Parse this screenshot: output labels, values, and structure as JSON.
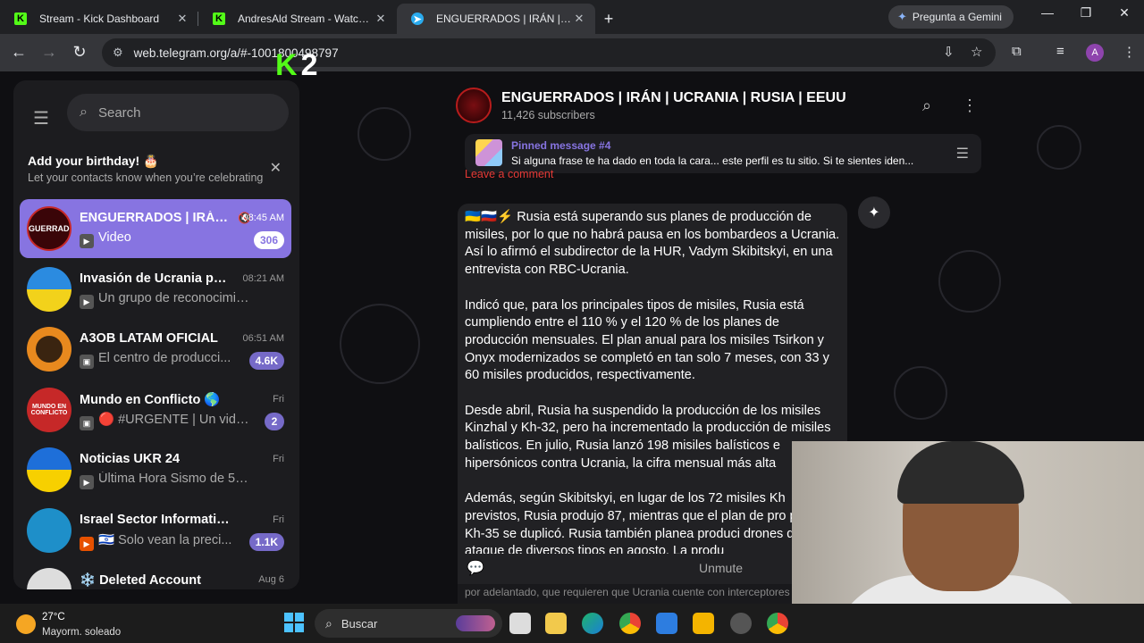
{
  "browser": {
    "tabs": [
      {
        "title": "Stream - Kick Dashboard",
        "icon": "kick-icon"
      },
      {
        "title": "AndresAld Stream - Watch Live",
        "icon": "kick-icon"
      },
      {
        "title": "ENGUERRADOS | IRÁN | UCRAN",
        "icon": "telegram-icon"
      }
    ],
    "gemini_label": "Pregunta a Gemini",
    "url": "web.telegram.org/a/#-1001800498797",
    "profile_initial": "A"
  },
  "overlay": {
    "kick_number": "2"
  },
  "sidebar": {
    "search_placeholder": "Search",
    "birthday": {
      "title": "Add your birthday! 🎂",
      "subtitle": "Let your contacts know when you’re celebrating"
    },
    "chats": [
      {
        "name": "ENGUERRADOS | IRÁN...",
        "time": "08:45 AM",
        "preview": "Video",
        "badge": "306",
        "avatar_text": "ENGUERRADOS"
      },
      {
        "name": "Invasión de Ucrania por ...",
        "time": "08:21 AM",
        "preview": "Un grupo de reconocimiento ...",
        "badge": "",
        "avatar_text": ""
      },
      {
        "name": "A3OB LATAM OFICIAL",
        "time": "06:51 AM",
        "preview": "El centro de producci...",
        "badge": "4.6K",
        "avatar_text": ""
      },
      {
        "name": "Mundo en Conflicto 🌎",
        "time": "Fri",
        "preview": "🔴 #URGENTE | Un video...",
        "badge": "2",
        "avatar_text": "MUNDO EN CONFLICTO"
      },
      {
        "name": "Noticias UKR 24",
        "time": "Fri",
        "preview": "Última Hora Sismo de 5.0 en...",
        "badge": "",
        "avatar_text": ""
      },
      {
        "name": "Israel Sector Informativo - Ca...",
        "time": "Fri",
        "preview": "🇮🇱 Solo vean la preci...",
        "badge": "1.1K",
        "avatar_text": ""
      },
      {
        "name": "❄️ Deleted Account",
        "time": "Aug 6",
        "preview": "",
        "badge": "",
        "avatar_text": ""
      }
    ]
  },
  "channel": {
    "title": "ENGUERRADOS | IRÁN | UCRANIA | RUSIA | EEUU",
    "subscribers": "11,426 subscribers",
    "pinned_label": "Pinned message #4",
    "pinned_text": "Si alguna frase te ha dado en toda la cara... este perfil es tu sitio. Si te sientes iden...",
    "comment_peek": "Leave a comment",
    "unmute_label": "Unmute"
  },
  "message": {
    "paragraphs": [
      "🇺🇦🇷🇺⚡ Rusia está superando sus planes de producción de misiles, por lo que no habrá pausa en los bombardeos a Ucrania. Así lo afirmó el subdirector de la HUR, Vadym Skibitskyi, en una entrevista con RBC-Ucrania.",
      "Indicó que, para los principales tipos de misiles, Rusia está cumpliendo entre el 110 % y el 120 % de los planes de producción mensuales. El plan anual para los misiles Tsirkon y Onyx modernizados se completó en tan solo 7 meses, con 33 y 60 misiles producidos, respectivamente.",
      "Desde abril, Rusia ha suspendido la producción de los misiles Kinzhal y Kh-32, pero ha incrementado la producción de misiles balísticos. En julio, Rusia lanzó 198 misiles balísticos e hipersónicos contra Ucrania, la cifra mensual más alta",
      "Además, según Skibitskyi, en lugar de los 72 misiles Kh previstos, Rusia produjo 87, mientras que el plan de pro para el Kh-35 se duplicó. Rusia también planea produci drones de ataque de diversos tipos en agosto. La produ"
    ],
    "bottom_peek": "por adelantado, que requieren que Ucrania cuente con interceptores más rápidos"
  },
  "taskbar": {
    "temperature": "27°C",
    "condition": "Mayorm. soleado",
    "search_label": "Buscar"
  },
  "colors": {
    "accent": "#8774e1",
    "kick_green": "#53fc18",
    "badge": "#766ac8"
  }
}
